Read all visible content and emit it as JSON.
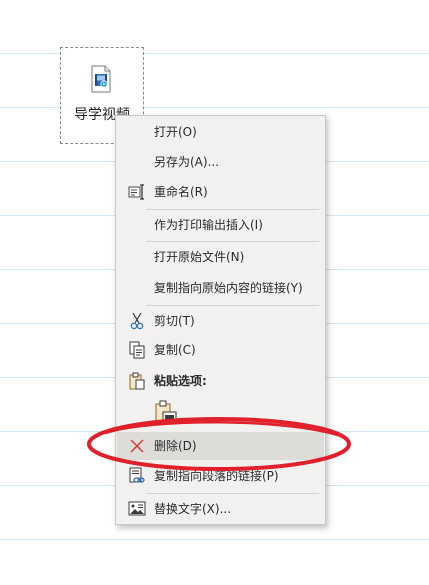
{
  "file_object": {
    "label": "导学视频",
    "icon": "video-file-icon"
  },
  "context_menu": {
    "items": [
      {
        "label": "打开(O)",
        "icon": ""
      },
      {
        "label": "另存为(A)...",
        "icon": ""
      },
      {
        "label": "重命名(R)",
        "icon": "rename-icon"
      },
      {
        "label": "作为打印输出插入(I)",
        "icon": ""
      },
      {
        "label": "打开原始文件(N)",
        "icon": ""
      },
      {
        "label": "复制指向原始内容的链接(Y)",
        "icon": ""
      },
      {
        "label": "剪切(T)",
        "icon": "scissors-icon"
      },
      {
        "label": "复制(C)",
        "icon": "copy-icon"
      },
      {
        "label": "粘贴选项:",
        "icon": "paste-icon"
      },
      {
        "label": "删除(D)",
        "icon": "delete-x-icon"
      },
      {
        "label": "复制指向段落的链接(P)",
        "icon": "link-paragraph-icon"
      },
      {
        "label": "替换文字(X)...",
        "icon": "alt-text-icon"
      }
    ],
    "paste_option_icon": "paste-keep-source-icon",
    "hovered_item": "删除(D)"
  },
  "annotation": {
    "color": "#e0202a",
    "shape": "ellipse"
  },
  "colors": {
    "rule_line": "#d4e7f3",
    "menu_background": "#f2f1ef",
    "menu_hover": "#dedcd9",
    "delete_icon": "#d9362e"
  }
}
